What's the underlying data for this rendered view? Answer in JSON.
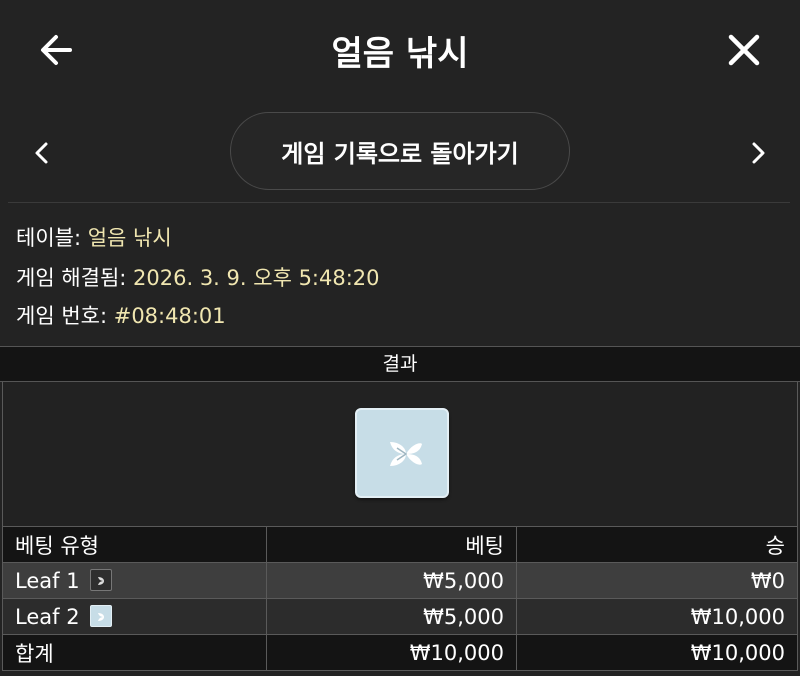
{
  "header": {
    "title": "얼음 낚시",
    "back_icon": "arrow-left-icon",
    "close_icon": "close-icon"
  },
  "nav": {
    "back_to_history": "게임 기록으로 돌아가기",
    "prev_icon": "chevron-left-icon",
    "next_icon": "chevron-right-icon"
  },
  "info": {
    "table_label": "테이블: ",
    "table_value": "얼음 낚시",
    "resolved_label": "게임 해결됨: ",
    "resolved_value": "2026. 3. 9. 오후 5:48:20",
    "game_no_label": "게임 번호: ",
    "game_no_value": "#08:48:01"
  },
  "result": {
    "label": "결과",
    "tile_icon": "leaf-icon"
  },
  "bets_table": {
    "headers": [
      "베팅 유형",
      "베팅",
      "승"
    ],
    "rows": [
      {
        "type": "Leaf 1",
        "icon": "leaf-dark-icon",
        "bet": "₩5,000",
        "win": "₩0"
      },
      {
        "type": "Leaf 2",
        "icon": "leaf-light-icon",
        "bet": "₩5,000",
        "win": "₩10,000"
      }
    ],
    "total": {
      "label": "합계",
      "bet": "₩10,000",
      "win": "₩10,000"
    }
  },
  "colors": {
    "background": "#232323",
    "accent_value": "#f0e6b0",
    "tile": "#c7dde7"
  }
}
